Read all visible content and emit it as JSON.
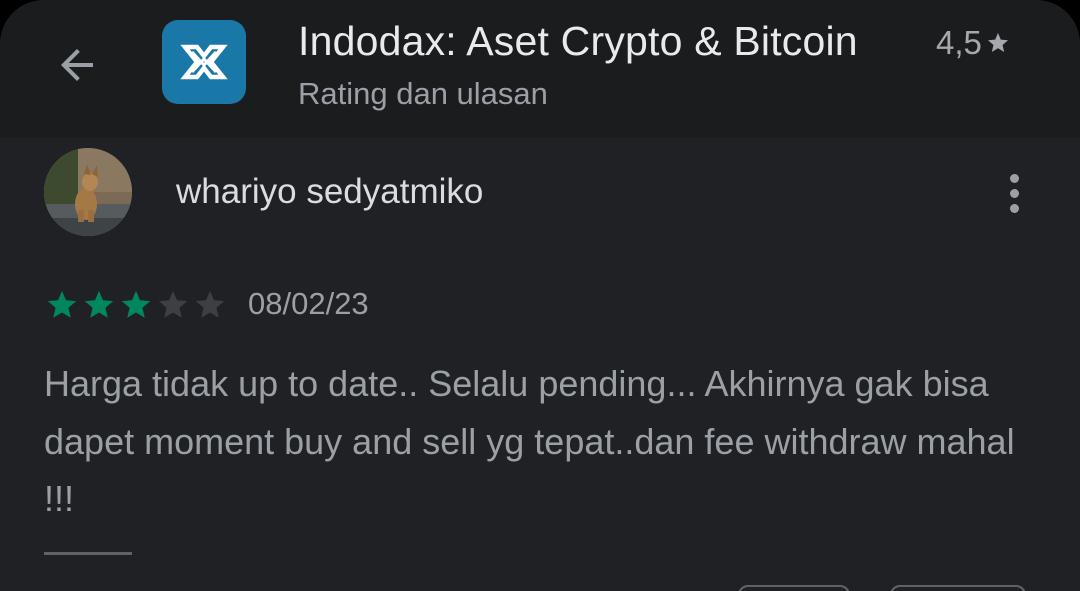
{
  "header": {
    "app_title": "Indodax: Aset Crypto & Bitcoin",
    "app_rating": "4,5",
    "subtitle": "Rating dan ulasan",
    "back_icon": "arrow-back-icon",
    "app_icon": "indodax-logo-icon"
  },
  "review": {
    "reviewer_name": "whariyo sedyatmiko",
    "avatar": "dog-photo-avatar",
    "rating": 3,
    "max_rating": 5,
    "date": "08/02/23",
    "text": "Harga tidak up to date.. Selalu pending... Akhirnya gak bisa dapet moment buy and sell yg tepat..dan fee withdraw mahal !!!",
    "more_icon": "more-vert-icon"
  },
  "colors": {
    "background": "#202124",
    "header_background": "#1b1c1e",
    "star_filled": "#01875f",
    "star_empty": "#3c4043",
    "app_icon_bg": "#1a78a8"
  }
}
